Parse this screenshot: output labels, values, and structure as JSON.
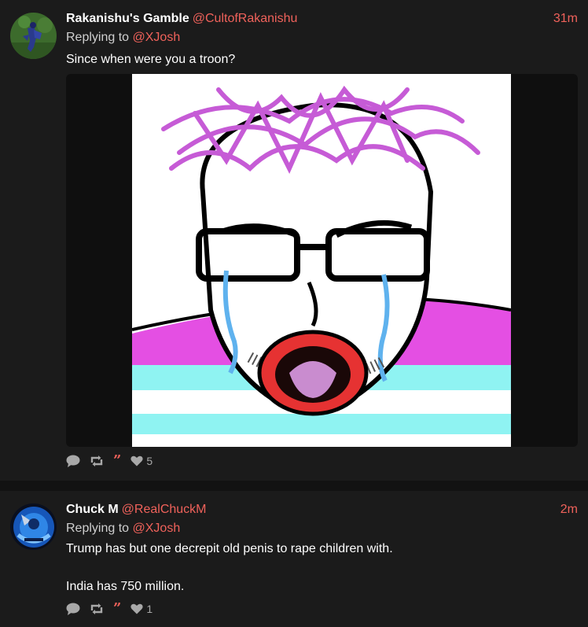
{
  "posts": [
    {
      "author": {
        "display_name": "Rakanishu's Gamble",
        "handle": "@CultofRakanishu"
      },
      "time": "31m",
      "replying_label": "Replying to ",
      "replying_to": "@XJosh",
      "text": "Since when were you a troon?",
      "has_image": true,
      "likes": "5"
    },
    {
      "author": {
        "display_name": "Chuck M",
        "handle": "@RealChuckM"
      },
      "time": "2m",
      "replying_label": "Replying to ",
      "replying_to": "@XJosh",
      "text": "Trump has but one decrepit old penis to rape children with.\n\nIndia has 750 million.",
      "has_image": false,
      "likes": "1"
    }
  ],
  "icons": {
    "reply": "speech-bubble-icon",
    "repost": "repost-icon",
    "quote": "quote-icon",
    "like": "heart-icon"
  },
  "colors": {
    "accent": "#f0625b",
    "background": "#1b1b1b",
    "divider": "#121212"
  }
}
